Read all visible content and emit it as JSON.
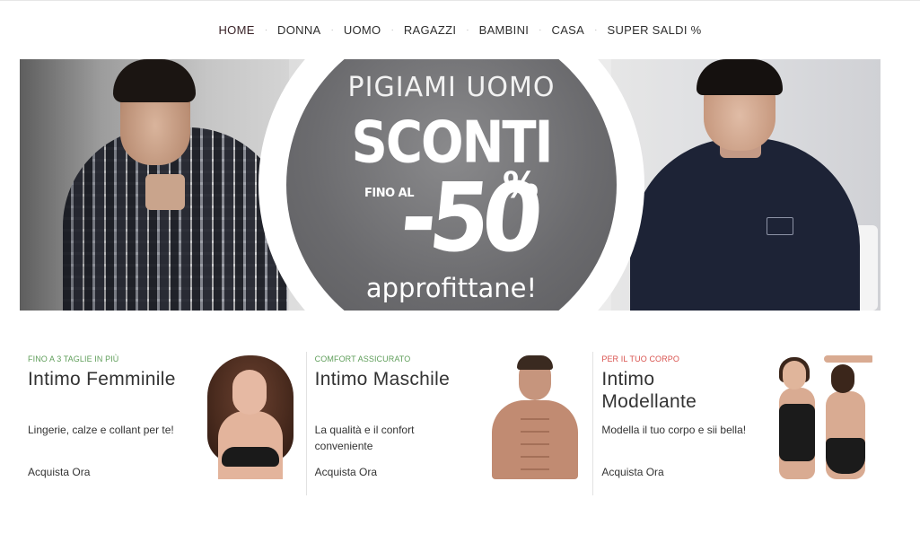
{
  "nav": {
    "items": [
      {
        "label": "HOME",
        "active": true
      },
      {
        "label": "DONNA"
      },
      {
        "label": "UOMO"
      },
      {
        "label": "RAGAZZI"
      },
      {
        "label": "BAMBINI"
      },
      {
        "label": "CASA"
      },
      {
        "label": "SUPER SALDI %"
      }
    ],
    "separator": "·"
  },
  "hero": {
    "headline": "PIGIAMI UOMO",
    "offer_word": "SCONTI",
    "offer_prefix": "FINO AL",
    "offer_value": "-50",
    "offer_percent": "%",
    "cta": "approfittane!"
  },
  "cards": [
    {
      "tag": "FINO A 3 TAGLIE IN PIÙ",
      "tag_color": "#5f9e5a",
      "title": "Intimo Femminile",
      "description": "Lingerie, calze e collant per te!",
      "cta": "Acquista Ora"
    },
    {
      "tag": "COMFORT ASSICURATO",
      "tag_color": "#5f9e5a",
      "title": "Intimo Maschile",
      "description": "La qualità e il confort conveniente",
      "cta": "Acquista Ora"
    },
    {
      "tag": "PER IL TUO CORPO",
      "tag_color": "#d9534f",
      "title": "Intimo Modellante",
      "description": "Modella il tuo corpo e sii bella!",
      "cta": "Acquista Ora"
    }
  ]
}
